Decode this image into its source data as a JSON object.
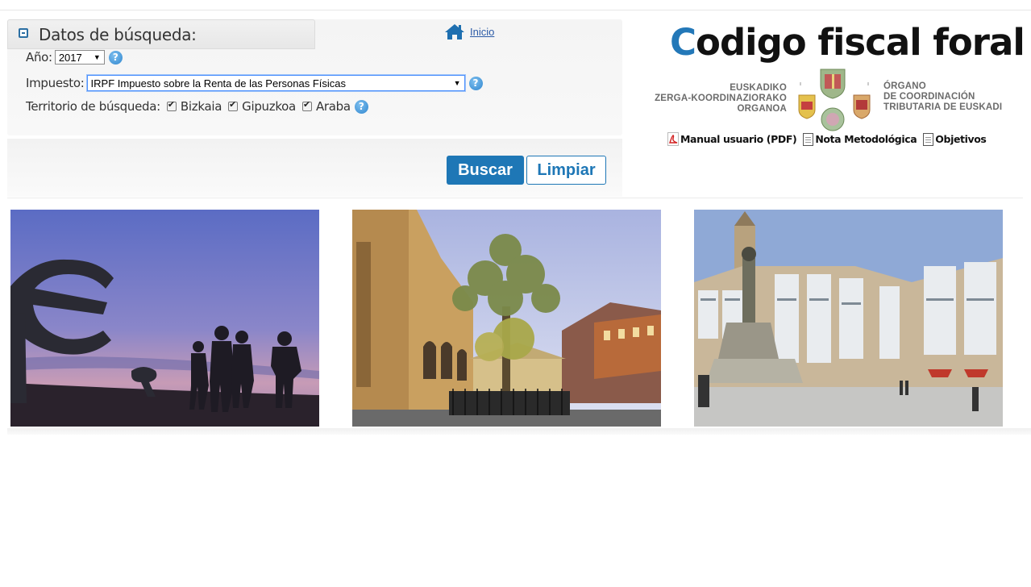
{
  "search_panel": {
    "title": "Datos de búsqueda:",
    "inicio_link": "Inicio",
    "year_label": "Año:",
    "year_value": "2017",
    "tax_label": "Impuesto:",
    "tax_value": "IRPF Impuesto sobre la Renta de las Personas Físicas",
    "territory_label": "Territorio de búsqueda:",
    "territories": [
      {
        "label": "Bizkaia",
        "checked": true
      },
      {
        "label": "Gipuzkoa",
        "checked": true
      },
      {
        "label": "Araba",
        "checked": true
      }
    ],
    "help_glyph": "?",
    "search_button": "Buscar",
    "clear_button": "Limpiar"
  },
  "header": {
    "brand_initial": "C",
    "brand_rest": "odigo fiscal foral",
    "org_basque": [
      "EUSKADIKO",
      "ZERGA-KOORDINAZIORAKO",
      "ORGANOA"
    ],
    "org_spanish": [
      "ÓRGANO",
      "DE COORDINACIÓN",
      "TRIBUTARIA DE EUSKADI"
    ],
    "links": [
      {
        "label": "Manual usuario (PDF)",
        "icon": "pdf-icon"
      },
      {
        "label": "Nota Metodológica",
        "icon": "document-icon"
      },
      {
        "label": "Objetivos",
        "icon": "document-icon"
      }
    ]
  },
  "photos": [
    {
      "name": "peine-del-viento-silhouettes"
    },
    {
      "name": "arbol-de-gernika"
    },
    {
      "name": "plaza-virgen-blanca"
    }
  ],
  "colors": {
    "accent": "#1e77b6",
    "brand_c": "#2378b8",
    "link": "#2b5aa6"
  }
}
